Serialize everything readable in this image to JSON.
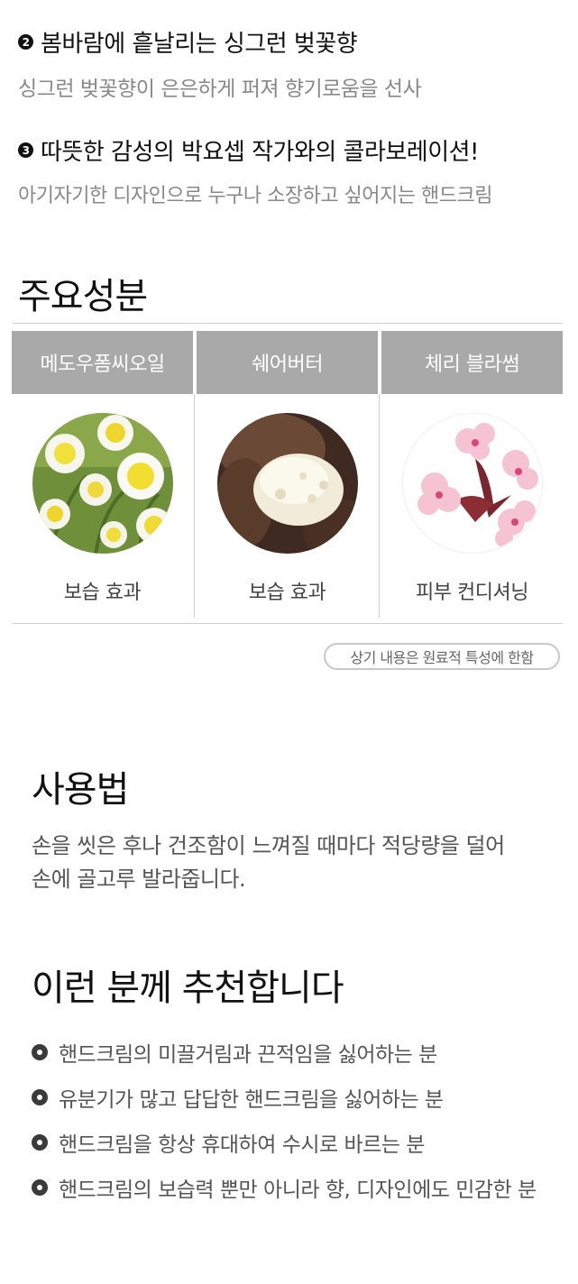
{
  "points": [
    {
      "badge": "2",
      "title": "봄바람에 흩날리는 싱그런 벚꽃향",
      "desc": "싱그런 벚꽃향이 은은하게 퍼져 향기로움을 선사"
    },
    {
      "badge": "3",
      "title": "따뜻한 감성의 박요셉 작가와의 콜라보레이션!",
      "desc": "아기자기한 디자인으로 누구나 소장하고 싶어지는 핸드크림"
    }
  ],
  "ingredients": {
    "title": "주요성분",
    "items": [
      {
        "name": "메도우폼씨오일",
        "effect": "보습 효과",
        "image": "meadowfoam-flower-image"
      },
      {
        "name": "쉐어버터",
        "effect": "보습 효과",
        "image": "shea-butter-image"
      },
      {
        "name": "체리 블라썸",
        "effect": "피부 컨디셔닝",
        "image": "cherry-blossom-image"
      }
    ],
    "note": "상기 내용은 원료적 특성에 한함"
  },
  "usage": {
    "title": "사용법",
    "lines": [
      "손을 씻은 후나 건조함이 느껴질 때마다 적당량을 덜어",
      "손에 골고루 발라줍니다."
    ]
  },
  "recommend": {
    "title": "이런 분께 추천합니다",
    "items": [
      "핸드크림의 미끌거림과 끈적임을 싫어하는 분",
      "유분기가 많고 답답한 핸드크림을 싫어하는 분",
      "핸드크림을 항상 휴대하여 수시로 바르는 분",
      "핸드크림의 보습력 뿐만 아니라 향, 디자인에도 민감한 분"
    ]
  },
  "colors": {
    "header_gray": "#a9a9a9",
    "divider": "#cfcfcf",
    "text_muted": "#888888"
  }
}
